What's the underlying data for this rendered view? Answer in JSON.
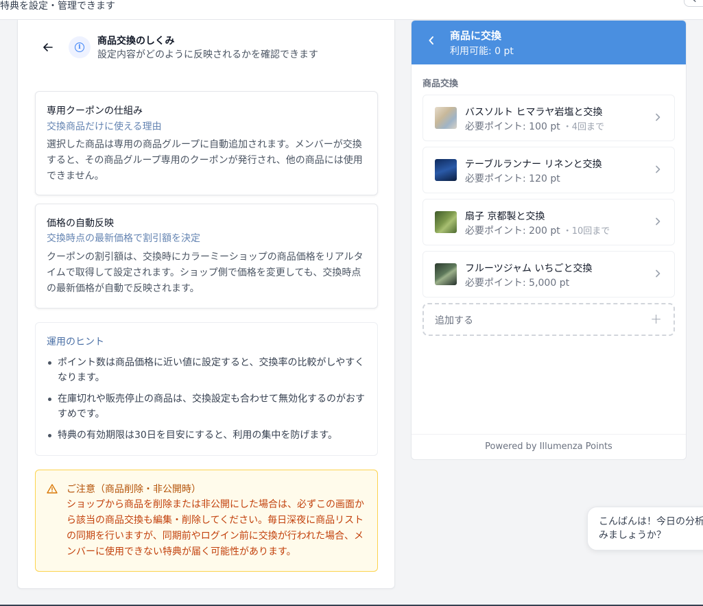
{
  "topbar": {
    "subtitle": "換特典を設定・管理できます",
    "corner_button": "く"
  },
  "guide": {
    "title": "商品交換のしくみ",
    "subtitle": "設定内容がどのように反映されるかを確認できます",
    "sections": [
      {
        "title": "専用クーポンの仕組み",
        "accent": "交換商品だけに使える理由",
        "body": "選択した商品は専用の商品グループに自動追加されます。メンバーが交換すると、その商品グループ専用のクーポンが発行され、他の商品には使用できません。"
      },
      {
        "title": "価格の自動反映",
        "accent": "交換時点の最新価格で割引額を決定",
        "body": "クーポンの割引額は、交換時にカラーミーショップの商品価格をリアルタイムで取得して設定されます。ショップ側で価格を変更しても、交換時点の最新価格が自動で反映されます。"
      }
    ],
    "tips": {
      "title": "運用のヒント",
      "items": [
        "ポイント数は商品価格に近い値に設定すると、交換率の比較がしやすくなります。",
        "在庫切れや販売停止の商品は、交換設定も合わせて無効化するのがおすすめです。",
        "特典の有効期限は30日を目安にすると、利用の集中を防げます。"
      ]
    },
    "warning": {
      "title": "ご注意（商品削除・非公開時）",
      "body": "ショップから商品を削除または非公開にした場合は、必ずこの画面から該当の商品交換も編集・削除してください。毎日深夜に商品リストの同期を行いますが、同期前やログイン前に交換が行われた場合、メンバーに使用できない特典が届く可能性があります。"
    }
  },
  "preview": {
    "title": "商品に交換",
    "points": "利用可能: 0 pt",
    "section_label": "商品交換",
    "items": [
      {
        "name": "バスソルト ヒマラヤ岩塩と交換",
        "points": "必要ポイント: 100 pt",
        "limit": "・4回まで"
      },
      {
        "name": "テーブルランナー リネンと交換",
        "points": "必要ポイント: 120 pt",
        "limit": ""
      },
      {
        "name": "扇子 京都製と交換",
        "points": "必要ポイント: 200 pt",
        "limit": "・10回まで"
      },
      {
        "name": "フルーツジャム いちごと交換",
        "points": "必要ポイント: 5,000 pt",
        "limit": ""
      }
    ],
    "add_label": "追加する",
    "footer": "Powered by Illumenza Points"
  },
  "chat": {
    "line1": "こんばんは！今日の分析",
    "line2": "みましょうか？"
  },
  "colors": {
    "accent_blue": "#4a8fe0",
    "warning_bg": "#fffbeb",
    "warning_text": "#c2410c"
  }
}
